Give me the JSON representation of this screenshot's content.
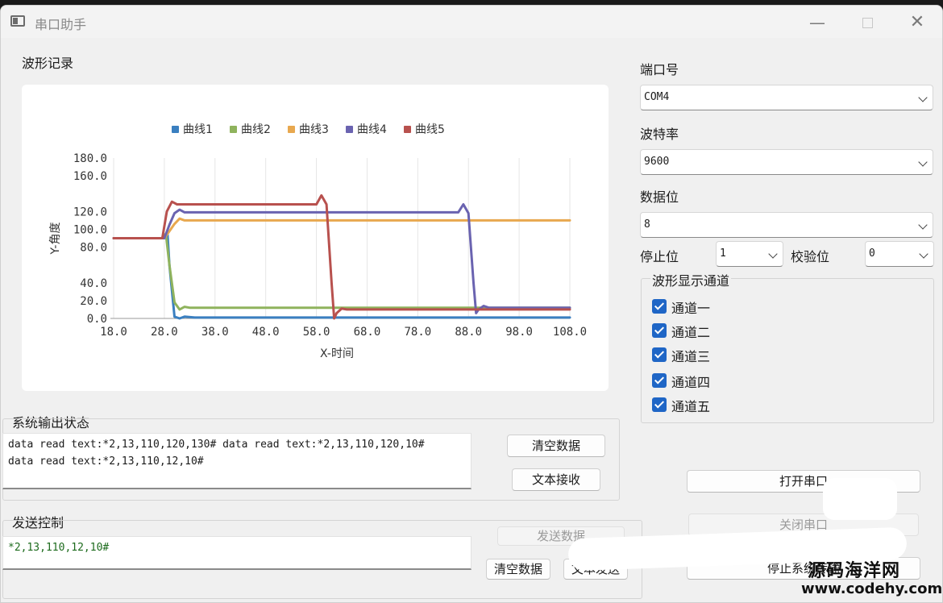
{
  "window": {
    "title": "串口助手",
    "minimize": "—",
    "close": "✕"
  },
  "waveform": {
    "title": "波形记录",
    "chart_data": {
      "type": "line",
      "xlabel": "X-时间",
      "ylabel": "Y-角度",
      "xlim": [
        18,
        108
      ],
      "ylim": [
        0,
        180
      ],
      "xticks": [
        "18.0",
        "28.0",
        "38.0",
        "48.0",
        "58.0",
        "68.0",
        "78.0",
        "88.0",
        "98.0",
        "108.0"
      ],
      "yticks": [
        "0.0",
        "20.0",
        "40.0",
        "80.0",
        "100.0",
        "120.0",
        "160.0",
        "180.0"
      ],
      "grid": "vertical",
      "legend_position": "top",
      "series": [
        {
          "name": "曲线1",
          "color": "#3a7fc0",
          "x": [
            18,
            28,
            28.6,
            29,
            30,
            31,
            32,
            34,
            60,
            62,
            108
          ],
          "y": [
            90,
            90,
            97,
            60,
            2,
            0,
            2,
            1,
            1,
            1,
            1
          ]
        },
        {
          "name": "曲线2",
          "color": "#8fb35d",
          "x": [
            18,
            27.5,
            28.3,
            29,
            30,
            31,
            32,
            33,
            34,
            60,
            62,
            108
          ],
          "y": [
            90,
            90,
            95,
            60,
            18,
            10,
            13,
            12,
            12,
            12,
            12,
            12
          ]
        },
        {
          "name": "曲线3",
          "color": "#e8a84f",
          "x": [
            18,
            28,
            29,
            30,
            31,
            32,
            33,
            108
          ],
          "y": [
            90,
            90,
            98,
            106,
            112,
            110,
            110,
            110
          ]
        },
        {
          "name": "曲线4",
          "color": "#6a63b0",
          "x": [
            18,
            28,
            29,
            30,
            31,
            32,
            33,
            34,
            86,
            87,
            88,
            89,
            89.5,
            90,
            91,
            92,
            108
          ],
          "y": [
            90,
            90,
            105,
            118,
            122,
            119,
            119,
            119,
            119,
            128,
            118,
            40,
            6,
            10,
            14,
            12,
            12
          ]
        },
        {
          "name": "曲线5",
          "color": "#b8514e",
          "x": [
            18,
            27.6,
            28.5,
            29.5,
            30.5,
            31.5,
            32.5,
            58,
            59,
            60,
            61,
            61.5,
            62,
            63,
            64,
            108
          ],
          "y": [
            90,
            90,
            120,
            131,
            128,
            128,
            128,
            128,
            138,
            128,
            40,
            0,
            6,
            11,
            10,
            10
          ]
        }
      ]
    }
  },
  "status": {
    "title": "系统输出状态",
    "lines": [
      "data read text:*2,13,110,120,130#  data read text:*2,13,110,120,10#",
      "data read text:*2,13,110,12,10#"
    ],
    "clear_button": "清空数据",
    "receive_button": "文本接收"
  },
  "send": {
    "title": "发送控制",
    "value": "*2,13,110,12,10#",
    "send_button": "发送数据",
    "clear_button": "清空数据",
    "text_send_button": "文本发送"
  },
  "serial": {
    "port_label": "端口号",
    "port_value": "COM4",
    "baud_label": "波特率",
    "baud_value": "9600",
    "databits_label": "数据位",
    "databits_value": "8",
    "stopbits_label": "停止位",
    "stopbits_value": "1",
    "parity_label": "校验位",
    "parity_value": "0",
    "open_button": "打开串口",
    "close_button": "关闭串口",
    "stop_button": "停止系统传输"
  },
  "channels": {
    "title": "波形显示通道",
    "items": [
      {
        "label": "通道一",
        "checked": true
      },
      {
        "label": "通道二",
        "checked": true
      },
      {
        "label": "通道三",
        "checked": true
      },
      {
        "label": "通道四",
        "checked": true
      },
      {
        "label": "通道五",
        "checked": true
      }
    ]
  },
  "watermark": {
    "line1": "源码海洋网",
    "line2": "www.codehy.com"
  },
  "colors": {
    "accent": "#1f66c6",
    "window_bg": "#f0f0f0"
  }
}
